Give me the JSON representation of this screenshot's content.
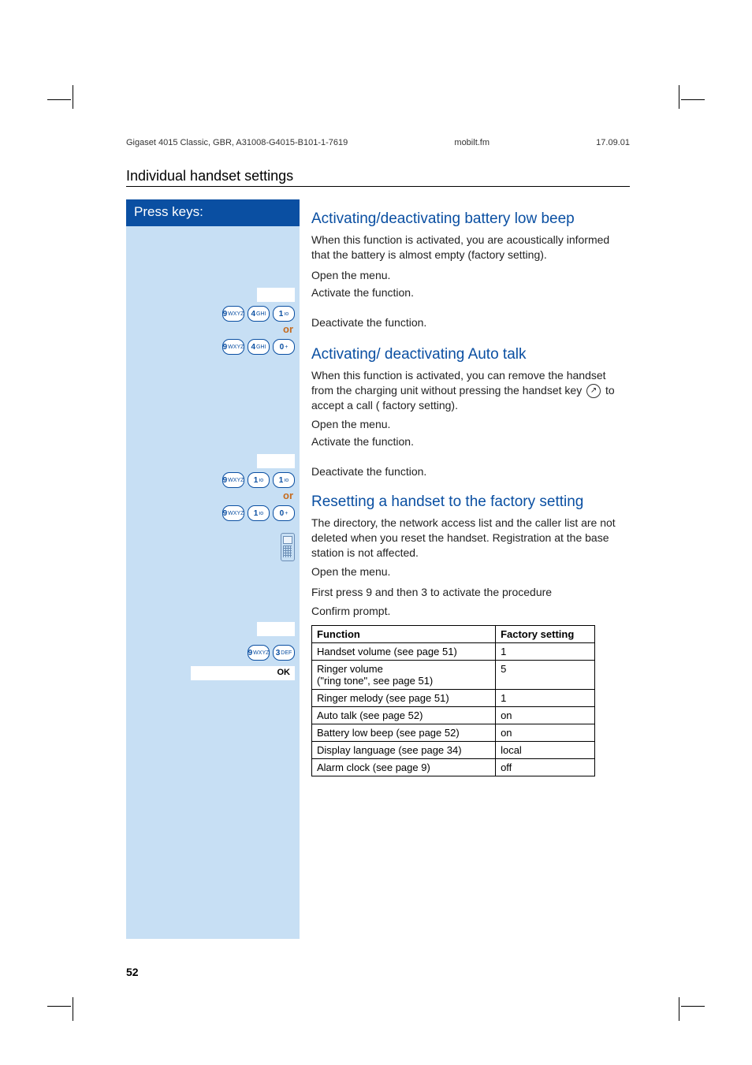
{
  "header": {
    "left": "Gigaset 4015 Classic, GBR, A31008-G4015-B101-1-7619",
    "mid": "mobilt.fm",
    "right": "17.09.01"
  },
  "section_title": "Individual handset settings",
  "sidebar_header": "Press keys:",
  "sections": {
    "battery": {
      "title": "Activating/deactivating battery low beep",
      "desc": "When this function is activated, you are acoustically informed that the battery is almost empty (factory setting).",
      "open_menu": "Open the menu.",
      "activate": "Activate the function.",
      "or": "or",
      "deactivate": "Deactivate the function."
    },
    "autotalk": {
      "title": "Activating/ deactivating Auto talk",
      "desc_pre": "When this function is activated, you can remove the handset from the charging unit without pressing the handset key ",
      "desc_post": " to accept a call ( factory setting).",
      "open_menu": "Open the menu.",
      "activate": "Activate the function.",
      "or": "or",
      "deactivate": "Deactivate the function."
    },
    "reset": {
      "title": "Resetting a handset to the factory setting",
      "desc": "The directory, the network access list and the caller list are not deleted when you reset the handset. Registration at the base station is not affected.",
      "open_menu": "Open the menu.",
      "press93": "First press 9 and then 3 to activate the procedure",
      "confirm": "Confirm prompt.",
      "ok_label": "OK"
    }
  },
  "keys": {
    "9": "9",
    "4": "4",
    "1": "1",
    "0": "0",
    "3": "3",
    "sub_wxyz": "WXYZ",
    "sub_ghi": "GHI",
    "sub_oo": "ıo",
    "sub_plus": "+",
    "sub_def": "DEF"
  },
  "table": {
    "headers": [
      "Function",
      "Factory setting"
    ],
    "rows": [
      [
        "Handset volume (see page 51)",
        "1"
      ],
      [
        "Ringer volume\n(\"ring tone\", see page 51)",
        "5"
      ],
      [
        "Ringer melody (see page 51)",
        "1"
      ],
      [
        "Auto talk (see page 52)",
        "on"
      ],
      [
        "Battery low beep (see page 52)",
        "on"
      ],
      [
        "Display language (see page 34)",
        "local"
      ],
      [
        "Alarm clock (see page 9)",
        "off"
      ]
    ]
  },
  "page_number": "52"
}
